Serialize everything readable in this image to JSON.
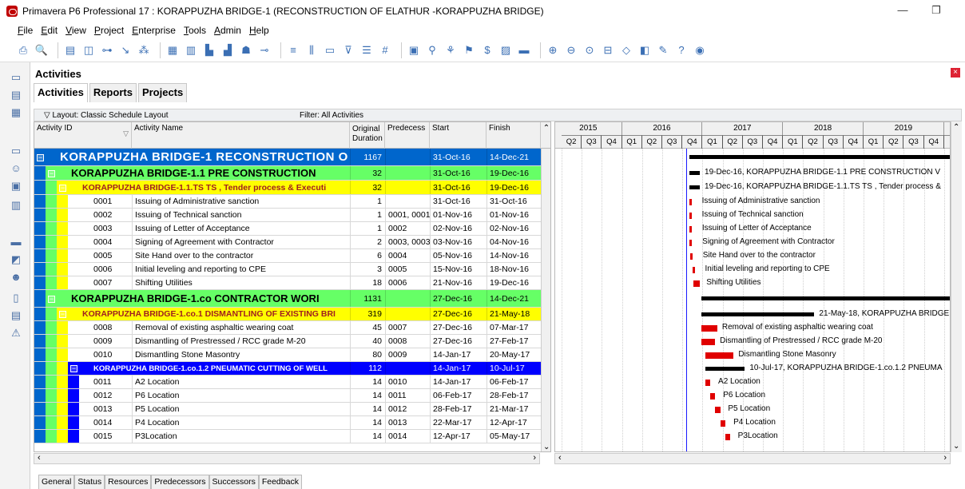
{
  "window": {
    "title": "Primavera P6 Professional 17 : KORAPPUZHA BRIDGE-1 (RECONSTRUCTION OF ELATHUR -KORAPPUZHA BRIDGE)",
    "minimize": "—",
    "restore": "❐"
  },
  "menu": [
    "File",
    "Edit",
    "View",
    "Project",
    "Enterprise",
    "Tools",
    "Admin",
    "Help"
  ],
  "panel": {
    "title": "Activities",
    "close": "×"
  },
  "tabs": [
    "Activities",
    "Reports",
    "Projects"
  ],
  "layout": {
    "label": "Layout: Classic Schedule Layout",
    "filter": "Filter: All Activities"
  },
  "columns": {
    "id": "Activity ID",
    "name": "Activity Name",
    "duration": "Original Duration",
    "pred": "Predecess",
    "start": "Start",
    "finish": "Finish"
  },
  "colors": {
    "project": "#0066cc",
    "wbs1": "#66ff66",
    "wbs2": "#ffff00",
    "wbs3": "#0000ff",
    "bar": "#e00000"
  },
  "rows": [
    {
      "kind": "project",
      "id": "",
      "name": "KORAPPUZHA BRIDGE-1 RECONSTRUCTION O",
      "dur": "1167",
      "pred": "",
      "start": "31-Oct-16",
      "finish": "14-Dec-21"
    },
    {
      "kind": "wbs1",
      "id": "",
      "name": "KORAPPUZHA BRIDGE-1.1 PRE CONSTRUCTION",
      "dur": "32",
      "pred": "",
      "start": "31-Oct-16",
      "finish": "19-Dec-16"
    },
    {
      "kind": "wbs2",
      "id": "",
      "name": "KORAPPUZHA BRIDGE-1.1.TS TS , Tender process & Executi",
      "dur": "32",
      "pred": "",
      "start": "31-Oct-16",
      "finish": "19-Dec-16"
    },
    {
      "kind": "act",
      "id": "0001",
      "name": "Issuing of Administrative sanction",
      "dur": "1",
      "pred": "",
      "start": "31-Oct-16",
      "finish": "31-Oct-16"
    },
    {
      "kind": "act",
      "id": "0002",
      "name": "Issuing of Technical sanction",
      "dur": "1",
      "pred": "0001, 0001",
      "start": "01-Nov-16",
      "finish": "01-Nov-16"
    },
    {
      "kind": "act",
      "id": "0003",
      "name": "Issuing of Letter of Acceptance",
      "dur": "1",
      "pred": "0002",
      "start": "02-Nov-16",
      "finish": "02-Nov-16"
    },
    {
      "kind": "act",
      "id": "0004",
      "name": "Signing of Agreement with Contractor",
      "dur": "2",
      "pred": "0003, 0003",
      "start": "03-Nov-16",
      "finish": "04-Nov-16"
    },
    {
      "kind": "act",
      "id": "0005",
      "name": "Site Hand over to the contractor",
      "dur": "6",
      "pred": "0004",
      "start": "05-Nov-16",
      "finish": "14-Nov-16"
    },
    {
      "kind": "act",
      "id": "0006",
      "name": "Initial leveling and reporting to CPE",
      "dur": "3",
      "pred": "0005",
      "start": "15-Nov-16",
      "finish": "18-Nov-16"
    },
    {
      "kind": "act",
      "id": "0007",
      "name": "Shifting Utilities",
      "dur": "18",
      "pred": "0006",
      "start": "21-Nov-16",
      "finish": "19-Dec-16"
    },
    {
      "kind": "wbs1",
      "id": "",
      "name": "KORAPPUZHA BRIDGE-1.co CONTRACTOR WORI",
      "dur": "1131",
      "pred": "",
      "start": "27-Dec-16",
      "finish": "14-Dec-21"
    },
    {
      "kind": "wbs2",
      "id": "",
      "name": "KORAPPUZHA BRIDGE-1.co.1 DISMANTLING OF EXISTING BRI",
      "dur": "319",
      "pred": "",
      "start": "27-Dec-16",
      "finish": "21-May-18"
    },
    {
      "kind": "act",
      "id": "0008",
      "name": "Removal of existing asphaltic wearing coat",
      "dur": "45",
      "pred": "0007",
      "start": "27-Dec-16",
      "finish": "07-Mar-17"
    },
    {
      "kind": "act",
      "id": "0009",
      "name": "Dismantling of Prestressed / RCC grade M-20",
      "dur": "40",
      "pred": "0008",
      "start": "27-Dec-16",
      "finish": "27-Feb-17"
    },
    {
      "kind": "act",
      "id": "0010",
      "name": "Dismantling Stone Masontry",
      "dur": "80",
      "pred": "0009",
      "start": "14-Jan-17",
      "finish": "20-May-17"
    },
    {
      "kind": "wbs3",
      "id": "",
      "name": "KORAPPUZHA BRIDGE-1.co.1.2 PNEUMATIC CUTTING OF WELL",
      "dur": "112",
      "pred": "",
      "start": "14-Jan-17",
      "finish": "10-Jul-17"
    },
    {
      "kind": "act3",
      "id": "0011",
      "name": "A2 Location",
      "dur": "14",
      "pred": "0010",
      "start": "14-Jan-17",
      "finish": "06-Feb-17"
    },
    {
      "kind": "act3",
      "id": "0012",
      "name": "P6 Location",
      "dur": "14",
      "pred": "0011",
      "start": "06-Feb-17",
      "finish": "28-Feb-17"
    },
    {
      "kind": "act3",
      "id": "0013",
      "name": "P5 Location",
      "dur": "14",
      "pred": "0012",
      "start": "28-Feb-17",
      "finish": "21-Mar-17"
    },
    {
      "kind": "act3",
      "id": "0014",
      "name": "P4 Location",
      "dur": "14",
      "pred": "0013",
      "start": "22-Mar-17",
      "finish": "12-Apr-17"
    },
    {
      "kind": "act3",
      "id": "0015",
      "name": "P3Location",
      "dur": "14",
      "pred": "0014",
      "start": "12-Apr-17",
      "finish": "05-May-17"
    }
  ],
  "gantt": {
    "years": [
      "2015",
      "2016",
      "2017",
      "2018",
      "2019"
    ],
    "quarters": [
      "Q2",
      "Q3",
      "Q4",
      "Q1",
      "Q2",
      "Q3",
      "Q4",
      "Q1",
      "Q2",
      "Q3",
      "Q4",
      "Q1",
      "Q2",
      "Q3",
      "Q4",
      "Q1",
      "Q2",
      "Q3",
      "Q4",
      "C"
    ],
    "labels": [
      "",
      "19-Dec-16, KORAPPUZHA BRIDGE-1.1  PRE CONSTRUCTION V",
      "19-Dec-16, KORAPPUZHA BRIDGE-1.1.TS  TS , Tender process &",
      "Issuing of Administrative sanction",
      "Issuing of Technical sanction",
      "Issuing of Letter of Acceptance",
      "Signing of Agreement with Contractor",
      "Site Hand over to the contractor",
      "Initial leveling and reporting to CPE",
      "Shifting Utilities",
      "",
      "21-May-18, KORAPPUZHA BRIDGE",
      "Removal of existing asphaltic wearing coat",
      "Dismantling of Prestressed / RCC grade M-20",
      "Dismantling Stone Masonry",
      "10-Jul-17, KORAPPUZHA BRIDGE-1.co.1.2  PNEUMA",
      "A2 Location",
      "P6 Location",
      "P5 Location",
      "P4 Location",
      "P3Location"
    ]
  },
  "bottom_tabs": [
    "General",
    "Status",
    "Resources",
    "Predecessors",
    "Successors",
    "Feedback"
  ]
}
